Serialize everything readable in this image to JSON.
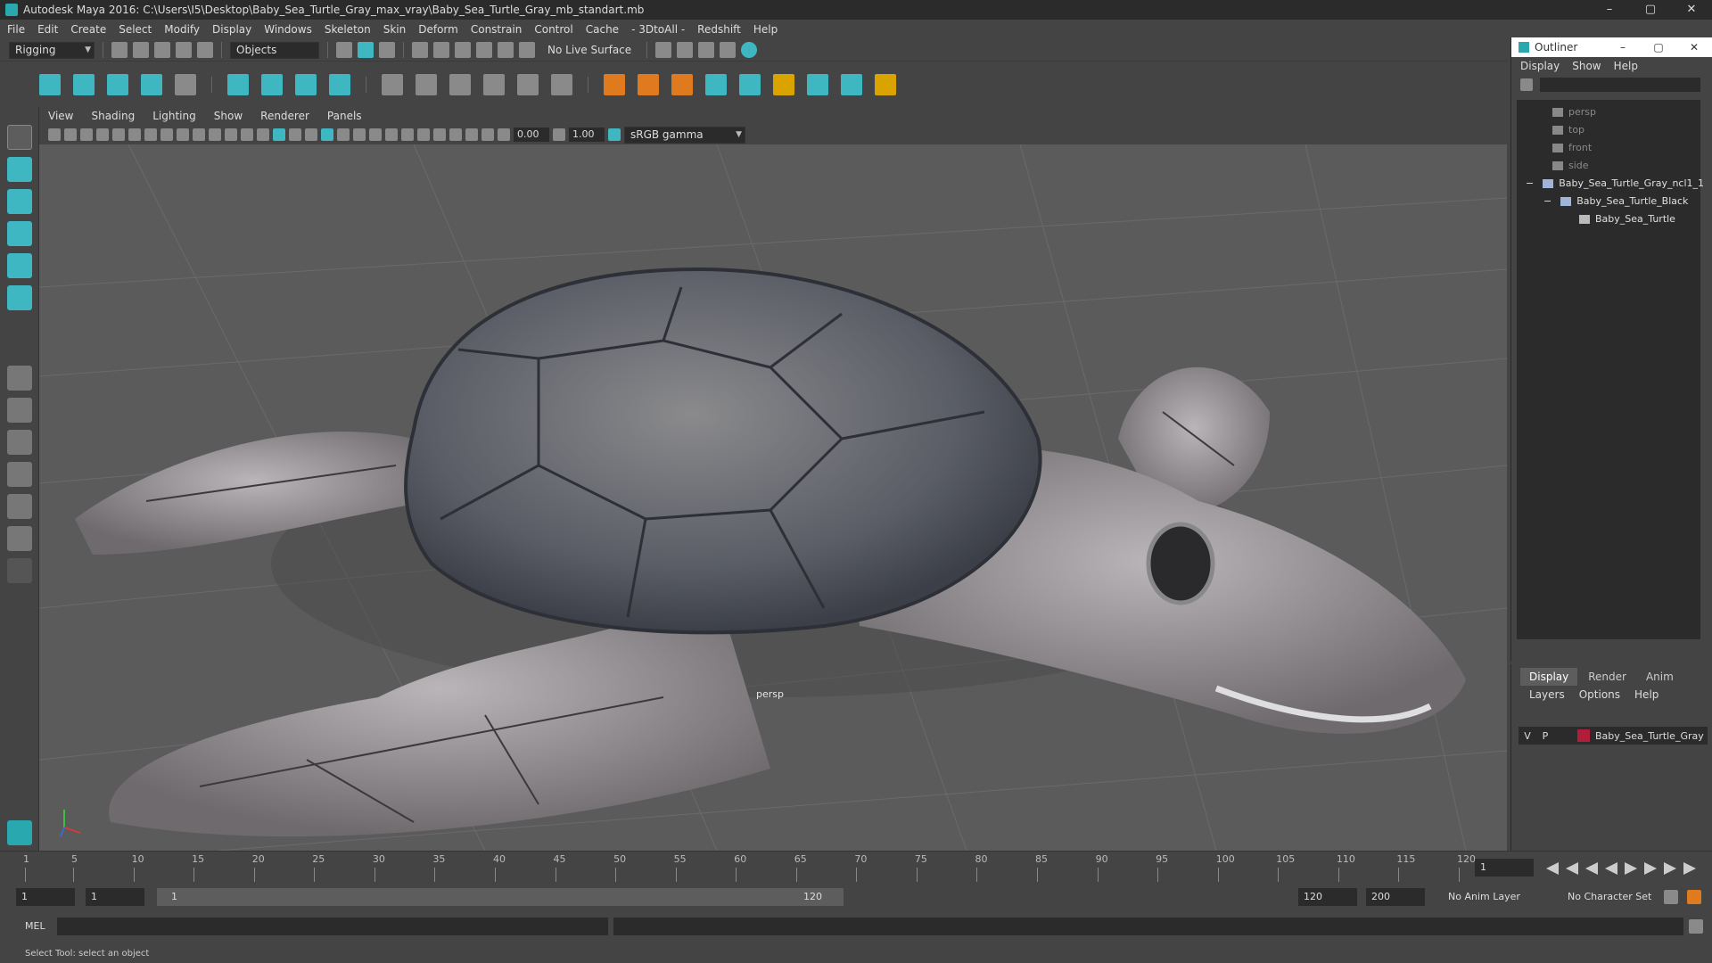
{
  "window": {
    "title": "Autodesk Maya 2016: C:\\Users\\I5\\Desktop\\Baby_Sea_Turtle_Gray_max_vray\\Baby_Sea_Turtle_Gray_mb_standart.mb",
    "min": "–",
    "max": "▢",
    "close": "✕"
  },
  "menubar": [
    "File",
    "Edit",
    "Create",
    "Select",
    "Modify",
    "Display",
    "Windows",
    "Skeleton",
    "Skin",
    "Deform",
    "Constrain",
    "Control",
    "Cache",
    "- 3DtoAll -",
    "Redshift",
    "Help"
  ],
  "statusline": {
    "mode": "Rigging",
    "selection_mask": "Objects",
    "live_surface": "No Live Surface"
  },
  "panel_menu": [
    "View",
    "Shading",
    "Lighting",
    "Show",
    "Renderer",
    "Panels"
  ],
  "panel_toolbar": {
    "exposure": "0.00",
    "gamma": "1.00",
    "color_space": "sRGB gamma"
  },
  "viewport": {
    "camera_label": "persp"
  },
  "outliner": {
    "title": "Outliner",
    "menu": [
      "Display",
      "Show",
      "Help"
    ],
    "items": [
      {
        "label": "persp",
        "indent": 0,
        "dim": true
      },
      {
        "label": "top",
        "indent": 0,
        "dim": true
      },
      {
        "label": "front",
        "indent": 0,
        "dim": true
      },
      {
        "label": "side",
        "indent": 0,
        "dim": true
      },
      {
        "label": "Baby_Sea_Turtle_Gray_ncl1_1",
        "indent": 0,
        "dim": false,
        "expander": "−"
      },
      {
        "label": "Baby_Sea_Turtle_Black",
        "indent": 1,
        "dim": false,
        "expander": "−"
      },
      {
        "label": "Baby_Sea_Turtle",
        "indent": 2,
        "dim": false
      }
    ]
  },
  "layers": {
    "tabs": [
      "Display",
      "Render",
      "Anim"
    ],
    "active_tab": "Display",
    "menu": [
      "Layers",
      "Options",
      "Help"
    ],
    "rows": [
      {
        "v": "V",
        "p": "P",
        "name": "Baby_Sea_Turtle_Gray",
        "color": "#b01e3c"
      }
    ]
  },
  "timeslider": {
    "ticks": [
      "1",
      "5",
      "10",
      "15",
      "20",
      "25",
      "30",
      "35",
      "40",
      "45",
      "50",
      "55",
      "60",
      "65",
      "70",
      "75",
      "80",
      "85",
      "90",
      "95",
      "100",
      "105",
      "110",
      "115",
      "120"
    ],
    "current_frame": "1"
  },
  "range": {
    "start": "1",
    "playback_start": "1",
    "range_start_label": "1",
    "range_end_label": "120",
    "playback_end": "120",
    "end": "200",
    "anim_layer": "No Anim Layer",
    "character_set": "No Character Set"
  },
  "cmdline": {
    "label": "MEL"
  },
  "helpline": "Select Tool: select an object"
}
